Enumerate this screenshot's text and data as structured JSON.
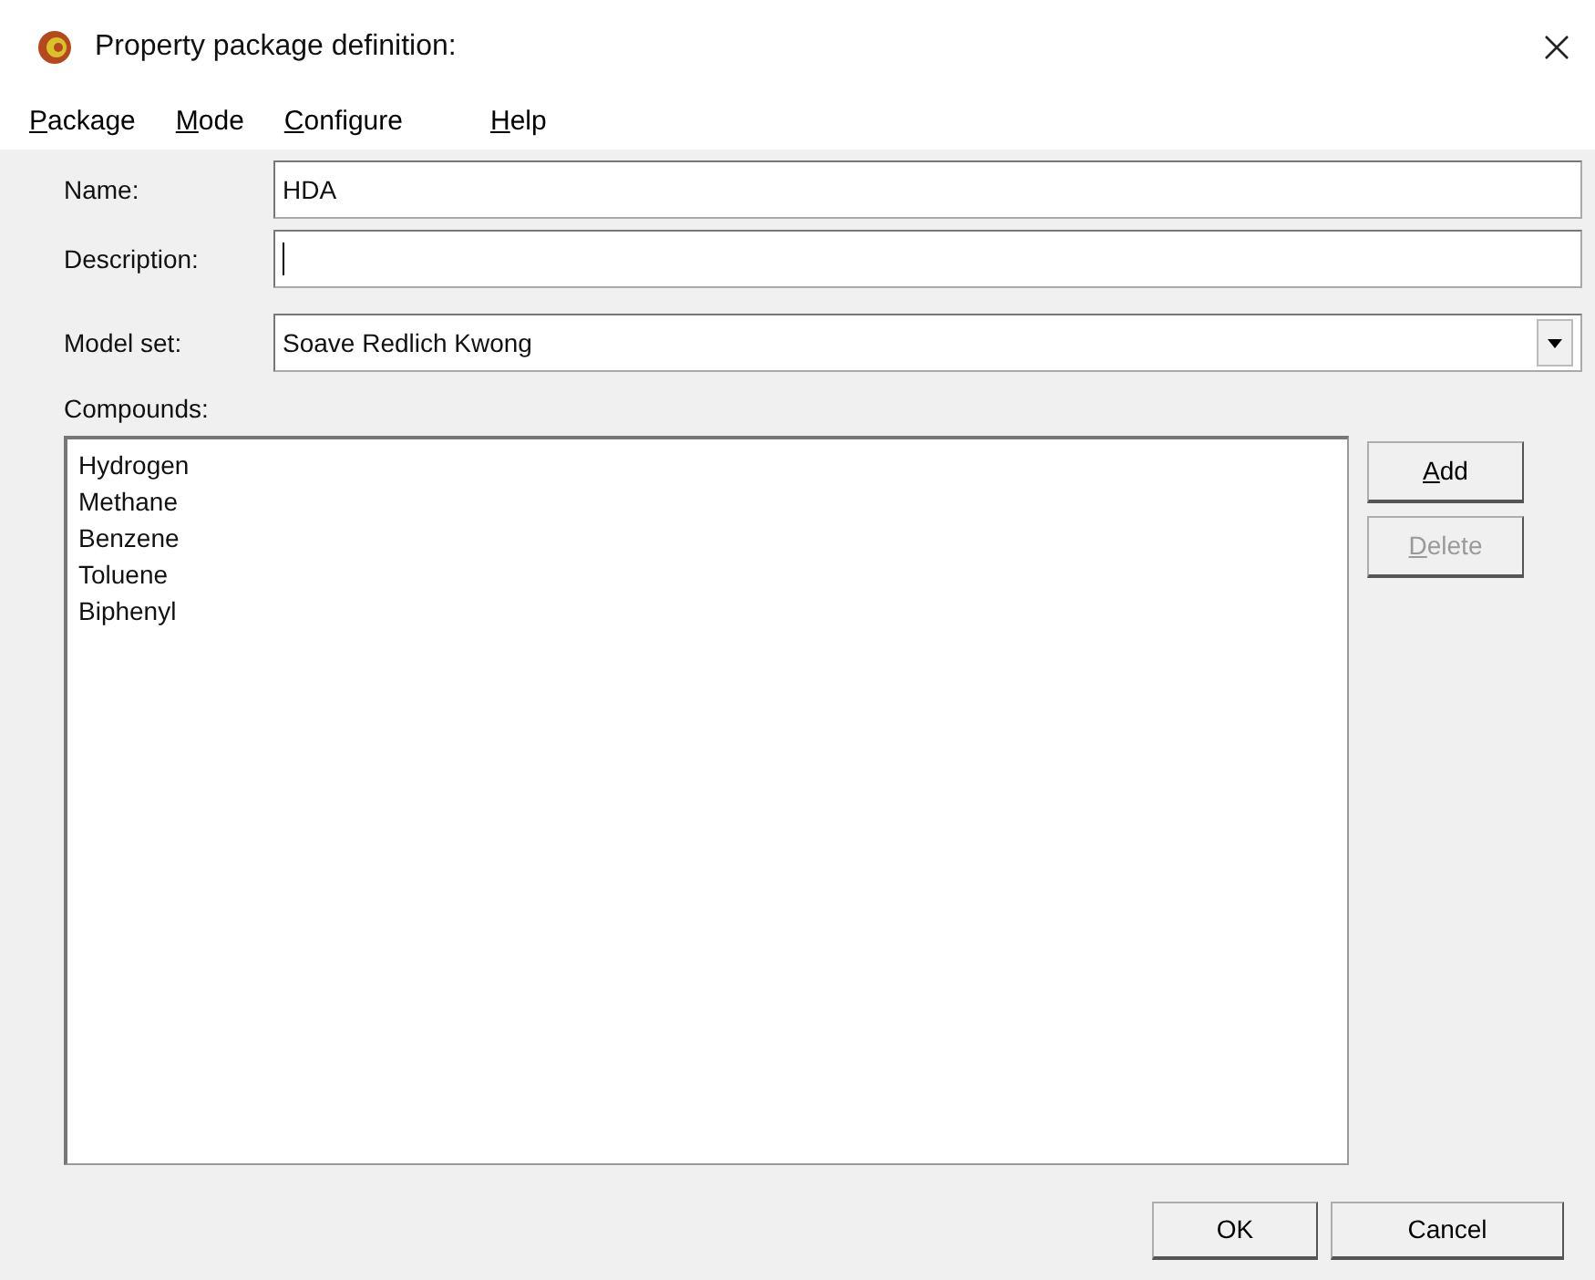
{
  "window": {
    "title": "Property package definition:"
  },
  "menu": [
    {
      "label": "Package"
    },
    {
      "label": "Mode"
    },
    {
      "label": "Configure"
    },
    {
      "label": "Help"
    }
  ],
  "fields": [
    {
      "label": "Name:",
      "kind": "text",
      "value": "HDA",
      "focused": false
    },
    {
      "label": "Description:",
      "kind": "text",
      "focused": true
    },
    {
      "label": "Model set:",
      "kind": "combo",
      "value": "Soave Redlich Kwong"
    }
  ],
  "compounds": {
    "label": "Compounds:",
    "items": [
      "Hydrogen",
      "Methane",
      "Benzene",
      "Toluene",
      "Biphenyl"
    ]
  },
  "side_buttons": [
    {
      "label": "Add",
      "disabled": false
    },
    {
      "label": "Delete",
      "disabled": true
    }
  ],
  "dialog_buttons": [
    {
      "label": "OK"
    },
    {
      "label": "Cancel"
    }
  ]
}
